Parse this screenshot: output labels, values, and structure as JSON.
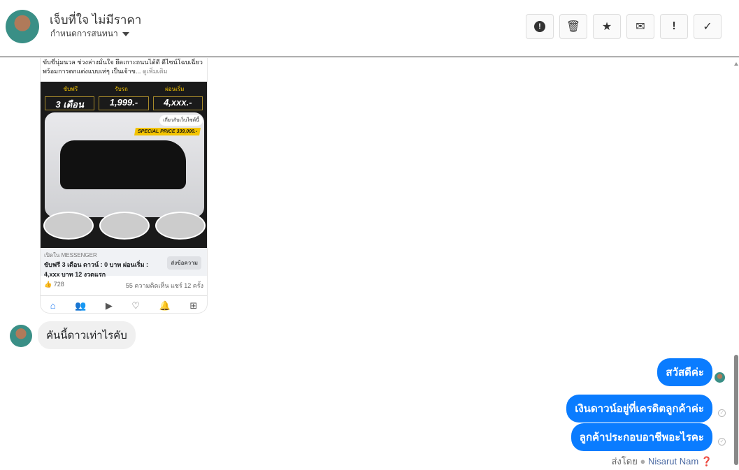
{
  "header": {
    "name": "เจ็บที่ใจ ไม่มีราคา",
    "assign_label": "กำหนดการสนทนา"
  },
  "toolbar": [
    {
      "name": "spam-button",
      "icon": "!"
    },
    {
      "name": "delete-button",
      "icon": "🗑"
    },
    {
      "name": "star-button",
      "icon": "★"
    },
    {
      "name": "mark-unread-button",
      "icon": "✉"
    },
    {
      "name": "important-button",
      "icon": "!"
    },
    {
      "name": "done-button",
      "icon": "✓"
    }
  ],
  "shared_post": {
    "caption": "ขับขี่นุ่มนวล ช่วงล่างมั่นใจ ยึดเกาะถนนได้ดี ดีไซน์โฉบเฉี่ยว พร้อมการตกแต่งแบบเท่ๆ เป็นเจ้าข...",
    "see_more": "ดูเพิ่มเติม",
    "ad_headers": [
      "ขับฟรี",
      "รับรถ",
      "ผ่อนเริ่ม"
    ],
    "ad_boxes": [
      "3 เดือน",
      "1,999.-",
      "4,xxx.-"
    ],
    "ad_info": "เกี่ยวกับเว็บไซต์นี้",
    "special_price": "SPECIAL PRICE 339,000.-",
    "messenger_label": "เปิดใน MESSENGER",
    "messenger_text": "ขับฟรี 3 เดือน ดาวน์ : 0 บาท ผ่อนเริ่ม : 4,xxx บาท 12 งวดแรก",
    "send_button": "ส่งข้อความ",
    "likes": "728",
    "comments_shares": "55 ความคิดเห็น  แชร์ 12 ครั้ง"
  },
  "messages": {
    "incoming": "คันนี้ดาวเท่าไรคับ",
    "outgoing": [
      "สวัสดีค่ะ",
      "เงินดาวน์อยู่ที่เครดิตลูกค้าค่ะ",
      "ลูกค้าประกอบอาชีพอะไรคะ"
    ],
    "sent_by_label": "ส่งโดย",
    "sender": "Nisarut Nam"
  }
}
